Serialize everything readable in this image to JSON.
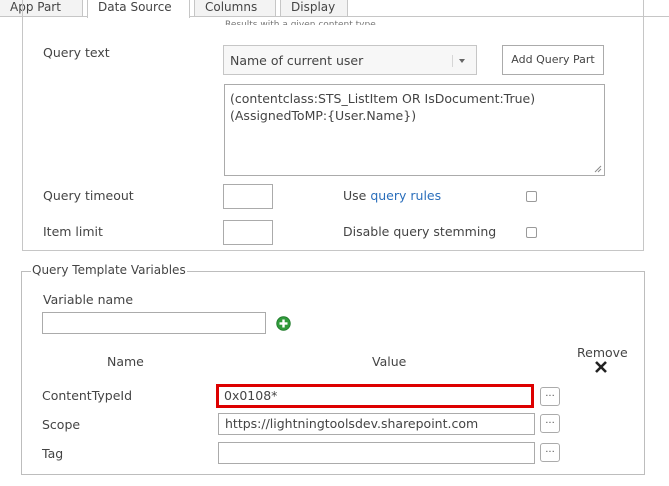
{
  "tabs": [
    "App Part",
    "Data Source",
    "Columns",
    "Display"
  ],
  "clipped_hint": "Results with a given content type.",
  "query_text": {
    "label": "Query text",
    "select_value": "Name of current user",
    "add_button": "Add Query Part",
    "text_line1": "(contentclass:STS_ListItem OR IsDocument:True)",
    "text_line2": "(AssignedToMP:{User.Name})"
  },
  "query_timeout": {
    "label": "Query timeout",
    "value": ""
  },
  "item_limit": {
    "label": "Item limit",
    "value": ""
  },
  "use_query_rules": {
    "prefix": "Use ",
    "link": "query rules",
    "checked": false
  },
  "disable_stemming": {
    "label": "Disable query stemming",
    "checked": false
  },
  "template_vars": {
    "legend": "Query Template Variables",
    "variable_name_label": "Variable name",
    "variable_name_value": "",
    "col_name": "Name",
    "col_value": "Value",
    "col_remove": "Remove",
    "rows": [
      {
        "name": "ContentTypeId",
        "value": "0x0108*"
      },
      {
        "name": "Scope",
        "value": "https://lightningtoolsdev.sharepoint.com"
      },
      {
        "name": "Tag",
        "value": ""
      }
    ],
    "ellipsis": "..."
  },
  "colors": {
    "highlight": "#dd0000",
    "link": "#2a6ebb",
    "add_icon": "#2f9a3a"
  }
}
